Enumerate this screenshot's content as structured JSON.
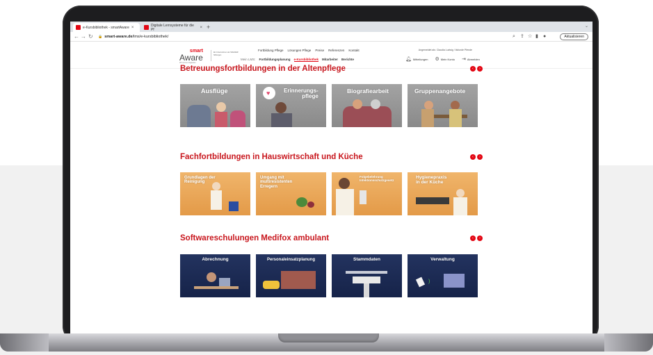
{
  "browser": {
    "tabs": [
      {
        "label": "e-Kursbibliothek - smartAware",
        "active": true
      },
      {
        "label": "Digitale Lernsysteme für die Pf",
        "active": false
      }
    ],
    "url_domain": "smart-aware.de",
    "url_path": "/lms/e-kursbibliothek/",
    "update_label": "Aktualisieren"
  },
  "site": {
    "logo_top": "smart",
    "logo_main": "Aware",
    "logo_tag": "Wir können Digitalien",
    "claim": "Ein Unternehmen der WAGNER Stiftungen",
    "topnav": [
      "Fortbildung Pflege",
      "Lösungen Pflege",
      "Preise",
      "Referenzen",
      "Kontakt"
    ],
    "mainnav_label": "Mein LMS:",
    "mainnav": [
      "Fortbildungsplanung",
      "e-Kursbibliothek",
      "Mitarbeiter",
      "Berichte"
    ],
    "user_line": "Angemeldet als: Claudia Ludwig / Ilsfunde Pfende",
    "usernav": [
      "Mitteilungen",
      "Mein Konto",
      "Abmelden"
    ]
  },
  "sections": [
    {
      "title": "Betreuungsfortbildungen in der Altenpflege",
      "cards": [
        "Ausflüge",
        "Erinnerungs-\npflege",
        "Biografiearbeit",
        "Gruppenangebote"
      ]
    },
    {
      "title": "Fachfortbildungen in Hauswirtschaft und Küche",
      "cards": [
        "Grundlagen der\nReinigung",
        "Umgang mit\nmultiresistenten\nErregern",
        "Folgebelehrung\nInfektionsschutzgesetz",
        "Hygienepraxis\nin der Küche"
      ]
    },
    {
      "title": "Softwareschulungen Medifox ambulant",
      "cards": [
        "Abrechnung",
        "Personaleinsatzplanung",
        "Stammdaten",
        "Verwaltung"
      ]
    }
  ],
  "colors": {
    "accent": "#e30613",
    "navy": "#1c2b55",
    "orange": "#e9a455",
    "grey": "#999999"
  }
}
